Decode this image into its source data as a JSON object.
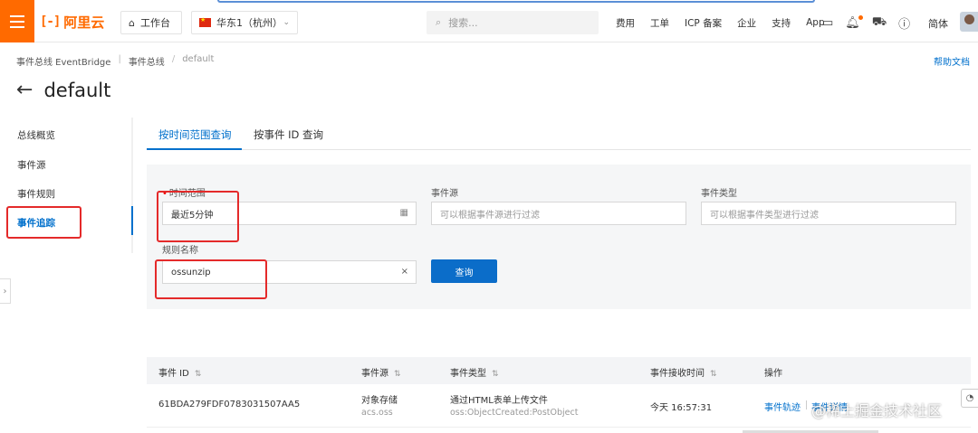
{
  "header": {
    "logo_text": "阿里云",
    "workspace": "工作台",
    "region": "华东1（杭州）",
    "search_placeholder": "搜索...",
    "nav": [
      "费用",
      "工单",
      "ICP 备案",
      "企业",
      "支持",
      "App"
    ],
    "lang": "简体"
  },
  "breadcrumb": [
    "事件总线 EventBridge",
    "事件总线",
    "default"
  ],
  "help_link": "帮助文档",
  "page_title": "default",
  "sidebar": {
    "items": [
      {
        "label": "总线概览"
      },
      {
        "label": "事件源"
      },
      {
        "label": "事件规则"
      },
      {
        "label": "事件追踪"
      }
    ]
  },
  "tabs": [
    {
      "label": "按时间范围查询"
    },
    {
      "label": "按事件 ID 查询"
    }
  ],
  "filters": {
    "time_range_label": "时间范围",
    "time_range_value": "最近5分钟",
    "source_label": "事件源",
    "source_placeholder": "可以根据事件源进行过滤",
    "type_label": "事件类型",
    "type_placeholder": "可以根据事件类型进行过滤",
    "rule_label": "规则名称",
    "rule_value": "ossunzip",
    "query_button": "查询"
  },
  "table": {
    "columns": [
      "事件 ID",
      "事件源",
      "事件类型",
      "事件接收时间",
      "操作"
    ],
    "rows": [
      {
        "id": "61BDA279FDF0783031507AA5",
        "source": "对象存储",
        "source_sub": "acs.oss",
        "type": "通过HTML表单上传文件",
        "type_sub": "oss:ObjectCreated:PostObject",
        "time": "今天 16:57:31",
        "action1": "事件轨迹",
        "action2": "事件详情"
      }
    ]
  },
  "watermark": "@稀土掘金技术社区",
  "colors": {
    "brand": "#ff6a00",
    "primary": "#0070cc",
    "annotation": "#e42a2a"
  }
}
